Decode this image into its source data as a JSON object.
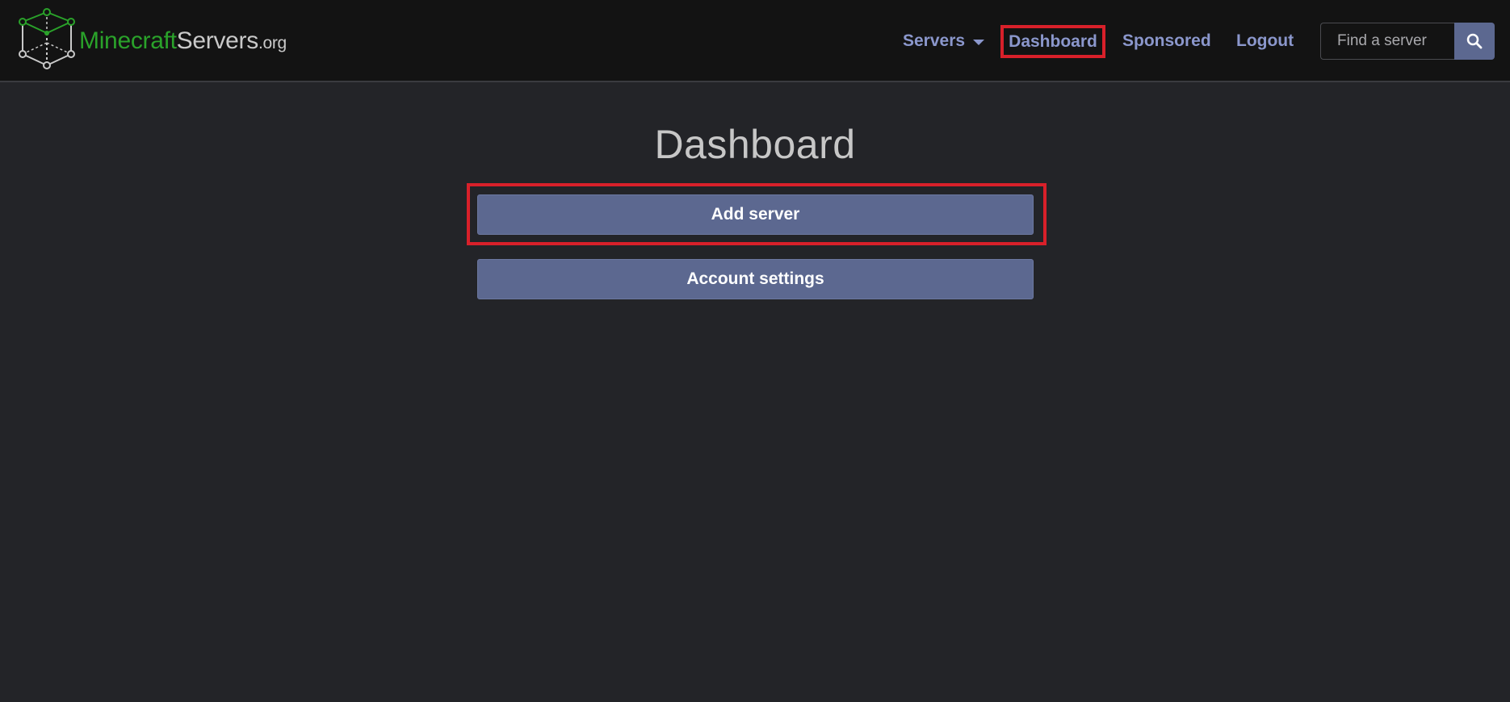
{
  "brand": {
    "name_part1": "Minecraft",
    "name_part2": "Servers",
    "name_tld": ".org",
    "logo_icon": "cube-network-icon"
  },
  "nav": {
    "servers_label": "Servers",
    "dashboard_label": "Dashboard",
    "sponsored_label": "Sponsored",
    "logout_label": "Logout"
  },
  "search": {
    "placeholder": "Find a server",
    "value": "",
    "icon": "search-icon"
  },
  "main": {
    "title": "Dashboard",
    "add_server_label": "Add server",
    "account_settings_label": "Account settings"
  },
  "colors": {
    "background": "#232428",
    "navbar": "#131313",
    "button": "#5c6890",
    "nav_link": "#8b97cc",
    "brand_green": "#2aa22a",
    "highlight_red": "#d8202a"
  }
}
